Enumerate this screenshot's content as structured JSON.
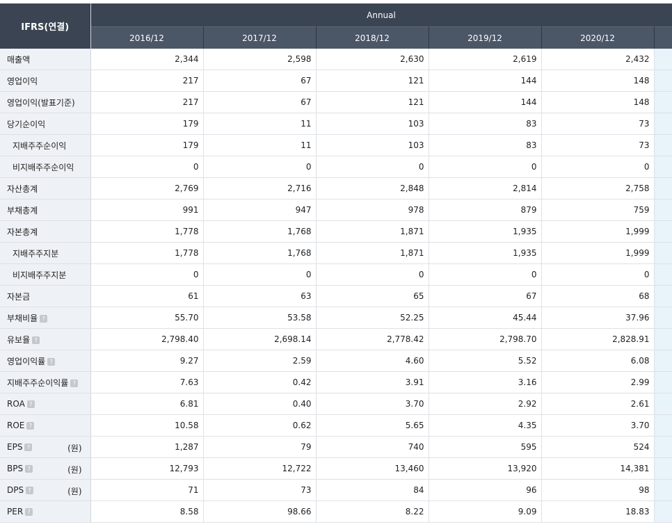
{
  "header": {
    "corner": "IFRS(연결)",
    "group": "Annual",
    "years": [
      "2016/12",
      "2017/12",
      "2018/12",
      "2019/12",
      "2020/12"
    ]
  },
  "icons": {
    "help": "question-mark-icon"
  },
  "rows": [
    {
      "label": "매출액",
      "sub": false,
      "help": false,
      "unit": "",
      "values": [
        "2,344",
        "2,598",
        "2,630",
        "2,619",
        "2,432"
      ]
    },
    {
      "label": "영업이익",
      "sub": false,
      "help": false,
      "unit": "",
      "values": [
        "217",
        "67",
        "121",
        "144",
        "148"
      ]
    },
    {
      "label": "영업이익(발표기준)",
      "sub": false,
      "help": false,
      "unit": "",
      "values": [
        "217",
        "67",
        "121",
        "144",
        "148"
      ]
    },
    {
      "label": "당기순이익",
      "sub": false,
      "help": false,
      "unit": "",
      "values": [
        "179",
        "11",
        "103",
        "83",
        "73"
      ]
    },
    {
      "label": "지배주주순이익",
      "sub": true,
      "help": false,
      "unit": "",
      "values": [
        "179",
        "11",
        "103",
        "83",
        "73"
      ]
    },
    {
      "label": "비지배주주순이익",
      "sub": true,
      "help": false,
      "unit": "",
      "values": [
        "0",
        "0",
        "0",
        "0",
        "0"
      ]
    },
    {
      "label": "자산총계",
      "sub": false,
      "help": false,
      "unit": "",
      "values": [
        "2,769",
        "2,716",
        "2,848",
        "2,814",
        "2,758"
      ]
    },
    {
      "label": "부채총계",
      "sub": false,
      "help": false,
      "unit": "",
      "values": [
        "991",
        "947",
        "978",
        "879",
        "759"
      ]
    },
    {
      "label": "자본총계",
      "sub": false,
      "help": false,
      "unit": "",
      "values": [
        "1,778",
        "1,768",
        "1,871",
        "1,935",
        "1,999"
      ]
    },
    {
      "label": "지배주주지분",
      "sub": true,
      "help": false,
      "unit": "",
      "values": [
        "1,778",
        "1,768",
        "1,871",
        "1,935",
        "1,999"
      ]
    },
    {
      "label": "비지배주주지분",
      "sub": true,
      "help": false,
      "unit": "",
      "values": [
        "0",
        "0",
        "0",
        "0",
        "0"
      ]
    },
    {
      "label": "자본금",
      "sub": false,
      "help": false,
      "unit": "",
      "values": [
        "61",
        "63",
        "65",
        "67",
        "68"
      ]
    },
    {
      "label": "부채비율",
      "sub": false,
      "help": true,
      "unit": "",
      "values": [
        "55.70",
        "53.58",
        "52.25",
        "45.44",
        "37.96"
      ]
    },
    {
      "label": "유보율",
      "sub": false,
      "help": true,
      "unit": "",
      "values": [
        "2,798.40",
        "2,698.14",
        "2,778.42",
        "2,798.70",
        "2,828.91"
      ]
    },
    {
      "label": "영업이익률",
      "sub": false,
      "help": true,
      "unit": "",
      "values": [
        "9.27",
        "2.59",
        "4.60",
        "5.52",
        "6.08"
      ]
    },
    {
      "label": "지배주주순이익률",
      "sub": false,
      "help": true,
      "unit": "",
      "values": [
        "7.63",
        "0.42",
        "3.91",
        "3.16",
        "2.99"
      ]
    },
    {
      "label": "ROA",
      "sub": false,
      "help": true,
      "unit": "",
      "values": [
        "6.81",
        "0.40",
        "3.70",
        "2.92",
        "2.61"
      ]
    },
    {
      "label": "ROE",
      "sub": false,
      "help": true,
      "unit": "",
      "values": [
        "10.58",
        "0.62",
        "5.65",
        "4.35",
        "3.70"
      ]
    },
    {
      "label": "EPS",
      "sub": false,
      "help": true,
      "unit": "(원)",
      "values": [
        "1,287",
        "79",
        "740",
        "595",
        "524"
      ]
    },
    {
      "label": "BPS",
      "sub": false,
      "help": true,
      "unit": "(원)",
      "values": [
        "12,793",
        "12,722",
        "13,460",
        "13,920",
        "14,381"
      ]
    },
    {
      "label": "DPS",
      "sub": false,
      "help": true,
      "unit": "(원)",
      "values": [
        "71",
        "73",
        "84",
        "96",
        "98"
      ]
    },
    {
      "label": "PER",
      "sub": false,
      "help": true,
      "unit": "",
      "values": [
        "8.58",
        "98.66",
        "8.22",
        "9.09",
        "18.83"
      ]
    }
  ]
}
